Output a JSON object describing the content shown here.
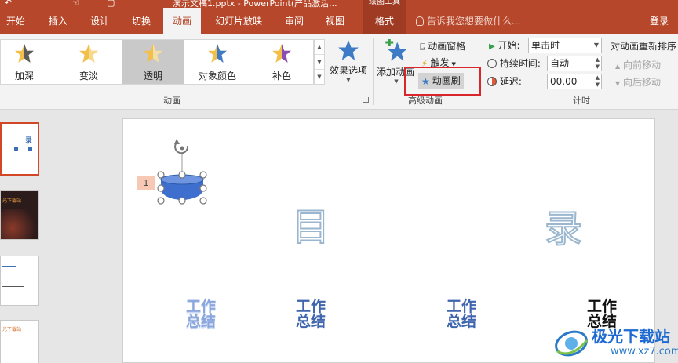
{
  "window": {
    "title": "演示文稿1.pptx - PowerPoint(产品激活...",
    "context_tab": "绘图工具"
  },
  "tabs": [
    "开始",
    "插入",
    "设计",
    "切换",
    "动画",
    "幻灯片放映",
    "审阅",
    "视图",
    "格式"
  ],
  "active_tab": "动画",
  "tell_me": "告诉我您想要做什么...",
  "sign_in": "登录",
  "animation_gallery": {
    "items": [
      {
        "label": "加深",
        "icon": "star-darken-icon"
      },
      {
        "label": "变淡",
        "icon": "star-lighten-icon"
      },
      {
        "label": "透明",
        "icon": "star-transparent-icon",
        "selected": true
      },
      {
        "label": "对象颜色",
        "icon": "star-object-color-icon"
      },
      {
        "label": "补色",
        "icon": "star-complementary-icon"
      }
    ],
    "group_label": "动画"
  },
  "effect_options": {
    "label": "效果选项"
  },
  "advanced": {
    "add_animation": "添加动画",
    "animation_pane": "动画窗格",
    "trigger": "触发",
    "animation_painter": "动画刷",
    "group_label": "高级动画"
  },
  "timing": {
    "start_label": "开始:",
    "start_value": "单击时",
    "duration_label": "持续时间:",
    "duration_value": "自动",
    "delay_label": "延迟:",
    "delay_value": "00.00",
    "group_label": "计时"
  },
  "reorder": {
    "title": "对动画重新排序",
    "move_earlier": "向前移动",
    "move_later": "向后移动"
  },
  "slide": {
    "animation_number": "1",
    "title_chars": [
      "目",
      "录"
    ],
    "items": [
      {
        "line1": "工作",
        "line2": "总结",
        "color": "#5b7fc4"
      },
      {
        "line1": "工作",
        "line2": "总结",
        "color": "#3e65ad"
      },
      {
        "line1": "工作",
        "line2": "总结",
        "color": "#3e65ad"
      },
      {
        "line1": "工作",
        "line2": "总结",
        "color": "#111111"
      }
    ]
  },
  "thumbnails": {
    "slide1_text": "录",
    "slide2_text": "光下载站",
    "slide4_text": "光下载站"
  },
  "watermark": {
    "title": "极光下载站",
    "url": "www.xz7.com"
  },
  "colors": {
    "accent": "#b7472a",
    "highlight_box": "#d9262a",
    "shape_fill": "#3f6fce"
  }
}
